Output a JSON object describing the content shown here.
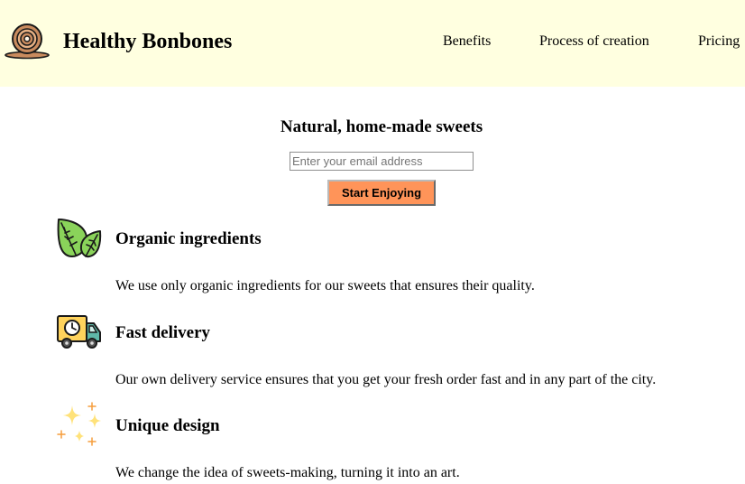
{
  "header": {
    "logo_icon": "bonbon-plate-icon",
    "brand": "Healthy Bonbones",
    "nav": [
      {
        "label": "Benefits"
      },
      {
        "label": "Process of creation"
      },
      {
        "label": "Pricing"
      }
    ]
  },
  "hero": {
    "title": "Natural, home-made sweets",
    "email_placeholder": "Enter your email address",
    "email_value": "",
    "cta_label": "Start Enjoying"
  },
  "features": [
    {
      "icon": "leaves-icon",
      "title": "Organic ingredients",
      "text": "We use only organic ingredients for our sweets that ensures their quality."
    },
    {
      "icon": "delivery-truck-icon",
      "title": "Fast delivery",
      "text": "Our own delivery service ensures that you get your fresh order fast and in any part of the city."
    },
    {
      "icon": "sparkles-icon",
      "title": "Unique design",
      "text": "We change the idea of sweets-making, turning it into an art."
    }
  ],
  "colors": {
    "header_bg": "#ffffe0",
    "cta_bg": "#ff9459",
    "leaf_green": "#8ad35a",
    "truck_yellow": "#ffd35c",
    "sparkle_yellow": "#ffe27a",
    "sparkle_orange": "#f59d3d",
    "logo_brown": "#c98b5e"
  }
}
